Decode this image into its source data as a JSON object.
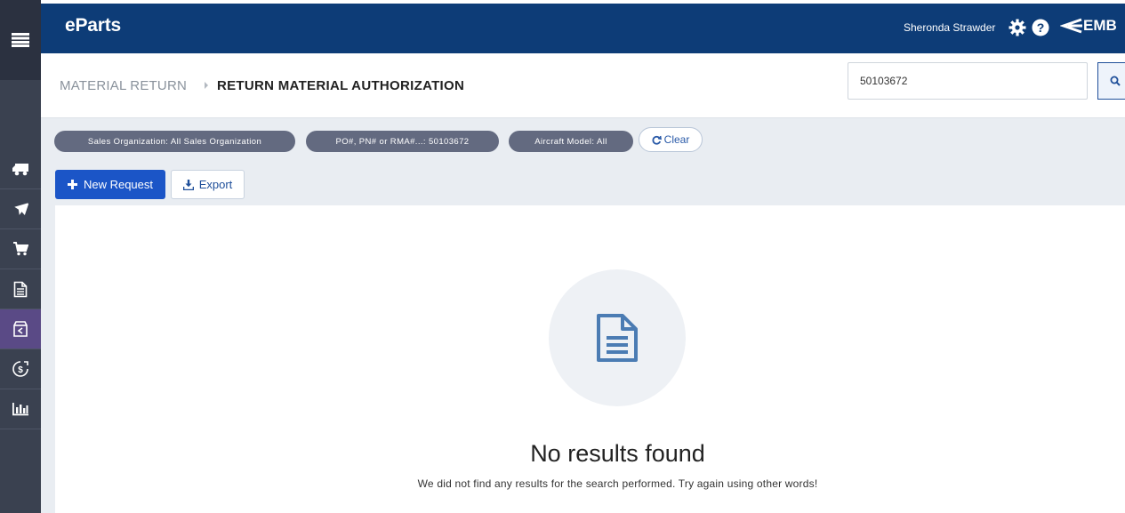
{
  "app": {
    "brand": "eParts",
    "user_name": "Sheronda Strawder",
    "logo_text": "EMB"
  },
  "sidebar": {
    "items": [
      {
        "icon": "truck-icon"
      },
      {
        "icon": "airplane-icon"
      },
      {
        "icon": "cart-icon"
      },
      {
        "icon": "document-icon"
      },
      {
        "icon": "return-box-icon",
        "active": true
      },
      {
        "icon": "dollar-icon"
      },
      {
        "icon": "bar-chart-icon"
      }
    ]
  },
  "breadcrumb": {
    "root": "MATERIAL RETURN",
    "current": "RETURN MATERIAL AUTHORIZATION"
  },
  "search": {
    "value": "50103672"
  },
  "filters": {
    "chips": [
      "Sales Organization: All Sales Organization",
      "PO#, PN# or RMA#...: 50103672",
      "Aircraft Model: All"
    ],
    "clear_label": "Clear"
  },
  "actions": {
    "new_request_label": "New Request",
    "export_label": "Export"
  },
  "empty_state": {
    "title": "No results found",
    "message": "We did not find any results for the search performed. Try again using other words!"
  },
  "colors": {
    "topbar": "#0d3c77",
    "sidebar": "#3a4150",
    "sidebar_active": "#5a4a86",
    "primary_button": "#1b55c7",
    "chip": "#636a80"
  }
}
